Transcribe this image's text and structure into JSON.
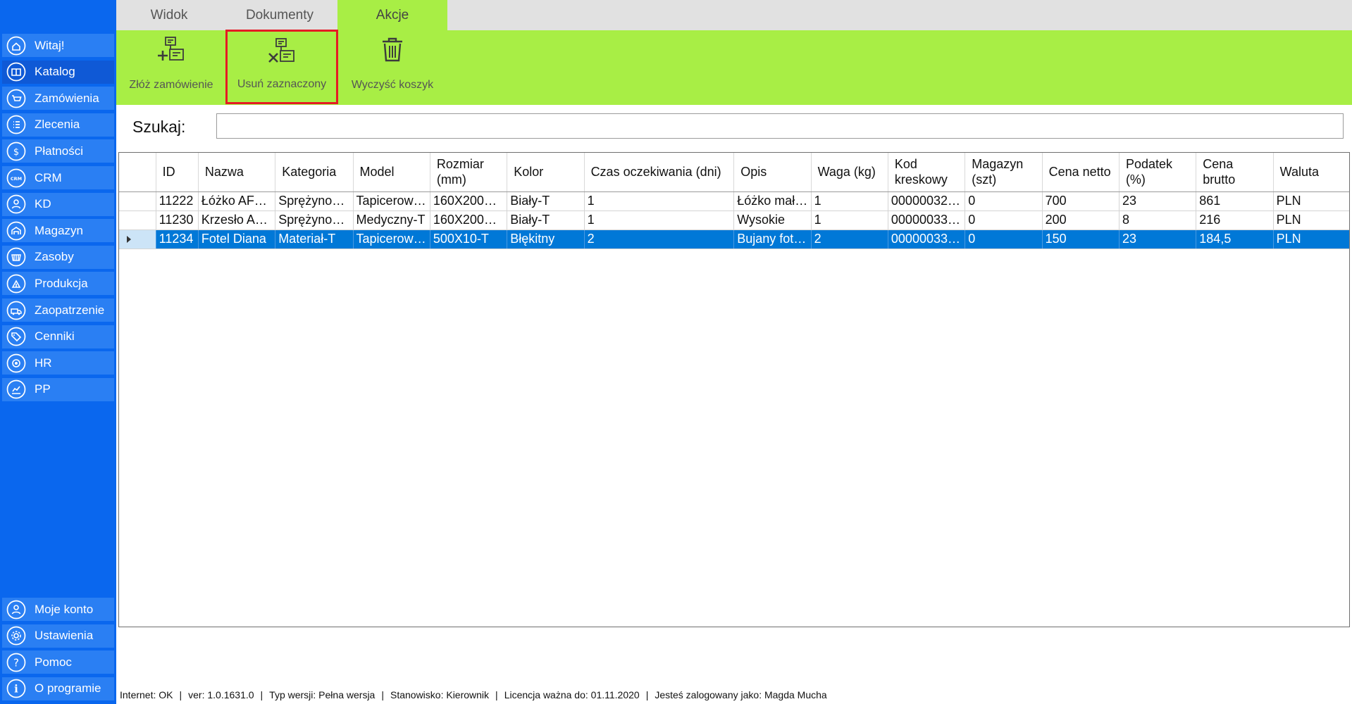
{
  "sidebar": {
    "items": [
      {
        "label": "Witaj!",
        "icon": "home-icon"
      },
      {
        "label": "Katalog",
        "icon": "book-icon"
      },
      {
        "label": "Zamówienia",
        "icon": "cart-icon"
      },
      {
        "label": "Zlecenia",
        "icon": "list-icon"
      },
      {
        "label": "Płatności",
        "icon": "dollar-icon"
      },
      {
        "label": "CRM",
        "icon": "crm-icon"
      },
      {
        "label": "KD",
        "icon": "person-icon"
      },
      {
        "label": "Magazyn",
        "icon": "warehouse-icon"
      },
      {
        "label": "Zasoby",
        "icon": "basket-icon"
      },
      {
        "label": "Produkcja",
        "icon": "factory-icon"
      },
      {
        "label": "Zaopatrzenie",
        "icon": "truck-icon"
      },
      {
        "label": "Cenniki",
        "icon": "tag-icon"
      },
      {
        "label": "HR",
        "icon": "target-icon"
      },
      {
        "label": "PP",
        "icon": "chart-icon"
      }
    ],
    "bottom_items": [
      {
        "label": "Moje konto",
        "icon": "account-icon"
      },
      {
        "label": "Ustawienia",
        "icon": "gear-icon"
      },
      {
        "label": "Pomoc",
        "icon": "help-icon"
      },
      {
        "label": "O programie",
        "icon": "info-icon"
      }
    ],
    "active": "Katalog"
  },
  "ribbon": {
    "tabs": [
      "Widok",
      "Dokumenty",
      "Akcje"
    ],
    "active_tab": "Akcje",
    "actions": [
      {
        "label": "Złóż zamówienie",
        "icon": "add-order-icon"
      },
      {
        "label": "Usuń zaznaczony",
        "icon": "remove-selected-icon"
      },
      {
        "label": "Wyczyść koszyk",
        "icon": "trash-icon"
      }
    ],
    "highlighted_action": "Usuń zaznaczony"
  },
  "search": {
    "label": "Szukaj:",
    "value": ""
  },
  "table": {
    "columns": [
      "ID",
      "Nazwa",
      "Kategoria",
      "Model",
      "Rozmiar (mm)",
      "Kolor",
      "Czas oczekiwania (dni)",
      "Opis",
      "Waga (kg)",
      "Kod kreskowy",
      "Magazyn (szt)",
      "Cena netto",
      "Podatek (%)",
      "Cena brutto",
      "Waluta"
    ],
    "rows": [
      [
        "11222",
        "Łóżko AF…",
        "Sprężyno…",
        "Tapicerow…",
        "160X200X…",
        "Biały-T",
        "1",
        "Łóżko mał…",
        "1",
        "00000032…",
        "0",
        "700",
        "23",
        "861",
        "PLN"
      ],
      [
        "11230",
        "Krzesło A…",
        "Sprężyno…",
        "Medyczny-T",
        "160X200X…",
        "Biały-T",
        "1",
        "Wysokie",
        "1",
        "00000033…",
        "0",
        "200",
        "8",
        "216",
        "PLN"
      ],
      [
        "11234",
        "Fotel Diana",
        "Materiał-T",
        "Tapicerow…",
        "500X10-T",
        "Błękitny",
        "2",
        "Bujany fot…",
        "2",
        "00000033…",
        "0",
        "150",
        "23",
        "184,5",
        "PLN"
      ]
    ],
    "selected_row": 2
  },
  "status": {
    "items": [
      "Internet: OK",
      "ver: 1.0.1631.0",
      "Typ wersji: Pełna wersja",
      "Stanowisko: Kierownik",
      "Licencja ważna do: 01.11.2020",
      "Jesteś zalogowany jako: Magda Mucha"
    ]
  },
  "colors": {
    "sidebar": "#0a67ee",
    "ribbon": "#a8ee45",
    "selection": "#0078d7",
    "highlight_border": "#e51b24"
  }
}
